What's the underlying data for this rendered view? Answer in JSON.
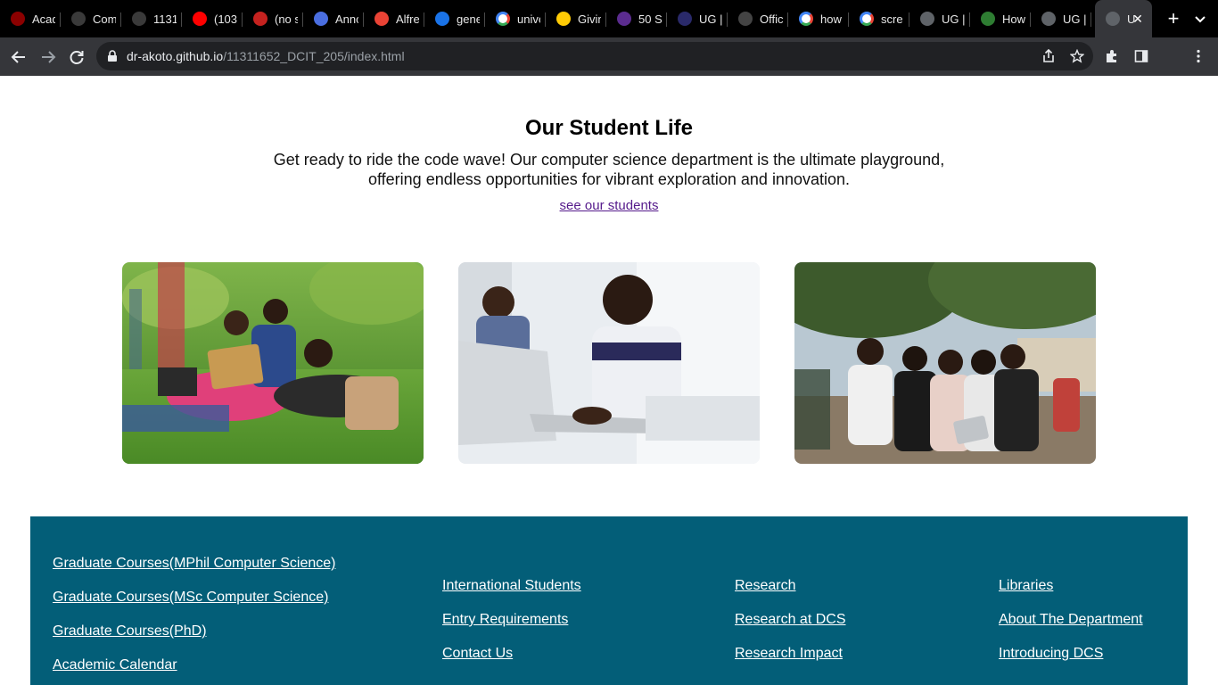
{
  "browser": {
    "tabs": [
      {
        "label": "Acad",
        "favicon": "ug-crest-icon",
        "color": "#8b0000"
      },
      {
        "label": "Com",
        "favicon": "github-icon",
        "color": "#3a3a3a"
      },
      {
        "label": "1131",
        "favicon": "github-icon",
        "color": "#3a3a3a"
      },
      {
        "label": "(103",
        "favicon": "youtube-icon",
        "color": "#ff0000"
      },
      {
        "label": "(no s",
        "favicon": "gmail-icon",
        "color": "#c5221f"
      },
      {
        "label": "Anno",
        "favicon": "doc-icon",
        "color": "#4a6ee0"
      },
      {
        "label": "Alfre",
        "favicon": "gmail-icon",
        "color": "#ea4335"
      },
      {
        "label": "gene",
        "favicon": "search-icon",
        "color": "#1a73e8"
      },
      {
        "label": "unive",
        "favicon": "google-icon",
        "color": "#ffffff"
      },
      {
        "label": "Givin",
        "favicon": "michigan-icon",
        "color": "#ffcb05"
      },
      {
        "label": "50 S",
        "favicon": "purple-crest-icon",
        "color": "#5b2c8f"
      },
      {
        "label": "UG |",
        "favicon": "ug-icon",
        "color": "#2a2a6a"
      },
      {
        "label": "Offic",
        "favicon": "office-icon",
        "color": "#444444"
      },
      {
        "label": "how",
        "favicon": "google-icon",
        "color": "#ffffff"
      },
      {
        "label": "scre",
        "favicon": "google-icon",
        "color": "#ffffff"
      },
      {
        "label": "UG |",
        "favicon": "globe-icon",
        "color": "#5f6368"
      },
      {
        "label": "How",
        "favicon": "image-icon",
        "color": "#2e7d32"
      },
      {
        "label": "UG |",
        "favicon": "globe-icon",
        "color": "#5f6368"
      }
    ],
    "active_tab": {
      "label": "U",
      "favicon": "globe-icon",
      "close_glyph": "✕"
    },
    "new_tab_glyph": "+",
    "url_host": "dr-akoto.github.io",
    "url_path": "/11311652_DCIT_205/index.html"
  },
  "student_life": {
    "title": "Our Student Life",
    "description": "Get ready to ride the code wave! Our computer science department is the ultimate playground, offering endless opportunities for vibrant exploration and innovation.",
    "link_text": "see our students"
  },
  "photos": [
    {
      "name": "students-on-grass-photo",
      "alt": "Students studying on the grass with laptops"
    },
    {
      "name": "student-with-laptop-photo",
      "alt": "Student smiling while working on a laptop"
    },
    {
      "name": "group-with-tablet-photo",
      "alt": "Group of students looking at a tablet under a tree"
    }
  ],
  "footer": {
    "col1": [
      "Graduate Courses(MPhil Computer Science)",
      "Graduate Courses(MSc Computer Science)",
      "Graduate Courses(PhD)",
      "Academic Calendar"
    ],
    "col2": [
      "International Students",
      "Entry Requirements",
      "Contact Us"
    ],
    "col3": [
      "Research",
      "Research at DCS",
      "Research Impact"
    ],
    "col4": [
      "Libraries",
      "About The Department",
      "Introducing DCS"
    ],
    "background_color": "#035e78"
  }
}
